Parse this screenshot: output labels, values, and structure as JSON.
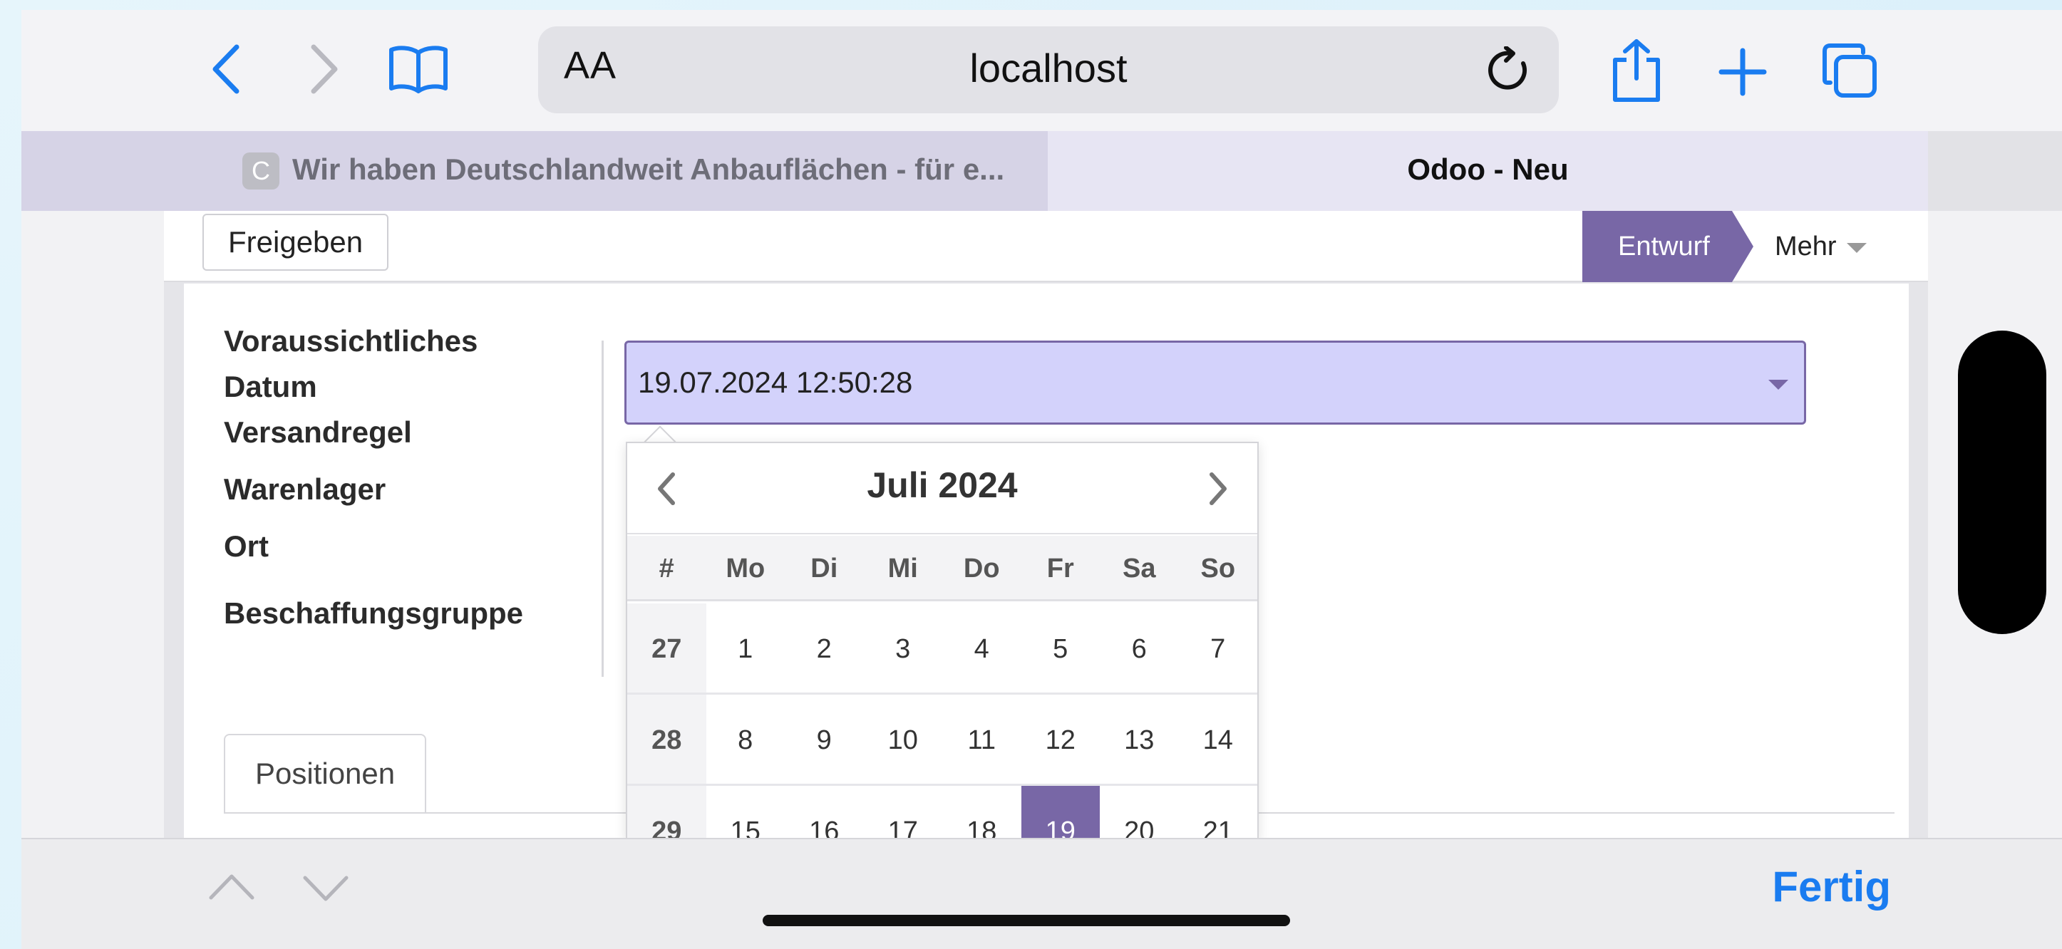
{
  "browser": {
    "address_aa": "AA",
    "url": "localhost",
    "tabs": [
      {
        "favicon": "C",
        "title": "Wir haben Deutschlandweit Anbauflächen - für e..."
      },
      {
        "title": "Odoo - Neu"
      }
    ],
    "done_label": "Fertig"
  },
  "statusbar": {
    "release_button": "Freigeben",
    "stage": "Entwurf",
    "more": "Mehr"
  },
  "form": {
    "labels": {
      "expected_date_1": "Voraussichtliches",
      "expected_date_2": "Datum",
      "shipping_rule": "Versandregel",
      "warehouse": "Warenlager",
      "location": "Ort",
      "procurement_group": "Beschaffungsgruppe"
    },
    "expected_date_value": "19.07.2024 12:50:28",
    "tab_positions": "Positionen"
  },
  "datepicker": {
    "month_label": "Juli 2024",
    "header": [
      "#",
      "Mo",
      "Di",
      "Mi",
      "Do",
      "Fr",
      "Sa",
      "So"
    ],
    "weeks": [
      [
        "27",
        "1",
        "2",
        "3",
        "4",
        "5",
        "6",
        "7"
      ],
      [
        "28",
        "8",
        "9",
        "10",
        "11",
        "12",
        "13",
        "14"
      ],
      [
        "29",
        "15",
        "16",
        "17",
        "18",
        "19",
        "20",
        "21"
      ]
    ],
    "selected_day": "19"
  },
  "colors": {
    "accent": "#7867a6",
    "input_bg": "#d3d2fb",
    "ios_blue": "#1a7cf0"
  }
}
